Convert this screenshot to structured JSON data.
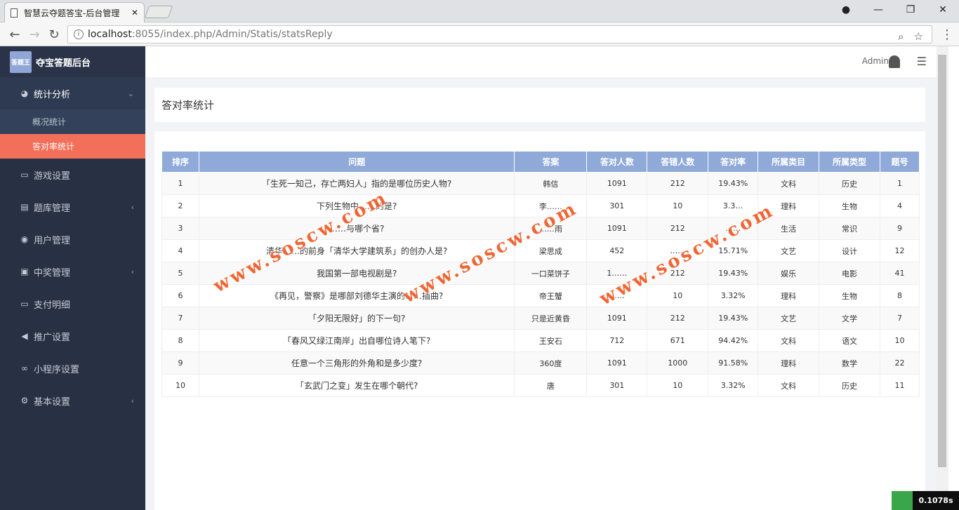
{
  "browser": {
    "tab_title": "智慧云夺题答宝-后台管理",
    "url_host": "localhost",
    "url_path": ":8055/index.php/Admin/Statis/statsReply"
  },
  "sidebar": {
    "brand": "夺宝答题后台",
    "logo_text": "答题王",
    "items": [
      {
        "label": "统计分析",
        "icon": "pie-chart-icon",
        "arrow": "⌄"
      },
      {
        "label": "概况统计",
        "sub": true
      },
      {
        "label": "答对率统计",
        "sub": true,
        "active": true
      },
      {
        "label": "游戏设置",
        "icon": "gamepad-icon"
      },
      {
        "label": "题库管理",
        "icon": "list-icon",
        "arrow": "‹"
      },
      {
        "label": "用户管理",
        "icon": "user-icon"
      },
      {
        "label": "中奖管理",
        "icon": "trophy-icon",
        "arrow": "‹"
      },
      {
        "label": "支付明细",
        "icon": "credit-card-icon"
      },
      {
        "label": "推广设置",
        "icon": "megaphone-icon"
      },
      {
        "label": "小程序设置",
        "icon": "link-icon"
      },
      {
        "label": "基本设置",
        "icon": "gear-icon",
        "arrow": "‹"
      }
    ]
  },
  "header": {
    "user": "Admin"
  },
  "page": {
    "title": "答对率统计"
  },
  "table": {
    "headers": [
      "排序",
      "问题",
      "答案",
      "答对人数",
      "答错人数",
      "答对率",
      "所属类目",
      "所属类型",
      "题号"
    ],
    "rows": [
      [
        "1",
        "「生死一知己，存亡两妇人」指的是哪位历史人物?",
        "韩信",
        "1091",
        "212",
        "19.43%",
        "文科",
        "历史",
        "1"
      ],
      [
        "2",
        "下列生物中……的是?",
        "李……",
        "301",
        "10",
        "3.3…",
        "理科",
        "生物",
        "4"
      ],
      [
        "3",
        "……与哪个省?",
        "……雨",
        "1091",
        "212",
        "……",
        "生活",
        "常识",
        "9"
      ],
      [
        "4",
        "清华……的前身「清华大学建筑系」的创办人是?",
        "梁思成",
        "452",
        "……",
        "15.71%",
        "文艺",
        "设计",
        "12"
      ],
      [
        "5",
        "我国第一部电视剧是?",
        "一口菜饼子",
        "1……",
        "212",
        "19.43%",
        "娱乐",
        "电影",
        "41"
      ],
      [
        "6",
        "《再见，警察》是哪部刘德华主演的……插曲?",
        "帝王蟹",
        "……",
        "10",
        "3.32%",
        "理科",
        "生物",
        "8"
      ],
      [
        "7",
        "「夕阳无限好」的下一句?",
        "只是近黄昏",
        "1091",
        "212",
        "19.43%",
        "文艺",
        "文学",
        "7"
      ],
      [
        "8",
        "「春风又绿江南岸」出自哪位诗人笔下?",
        "王安石",
        "712",
        "671",
        "94.42%",
        "文科",
        "语文",
        "10"
      ],
      [
        "9",
        "任意一个三角形的外角和是多少度?",
        "360度",
        "1091",
        "1000",
        "91.58%",
        "理科",
        "数学",
        "22"
      ],
      [
        "10",
        "「玄武门之变」发生在哪个朝代?",
        "唐",
        "301",
        "10",
        "3.32%",
        "文科",
        "历史",
        "11"
      ]
    ]
  },
  "watermark": "www.soscw.com",
  "timer": "0.1078s"
}
